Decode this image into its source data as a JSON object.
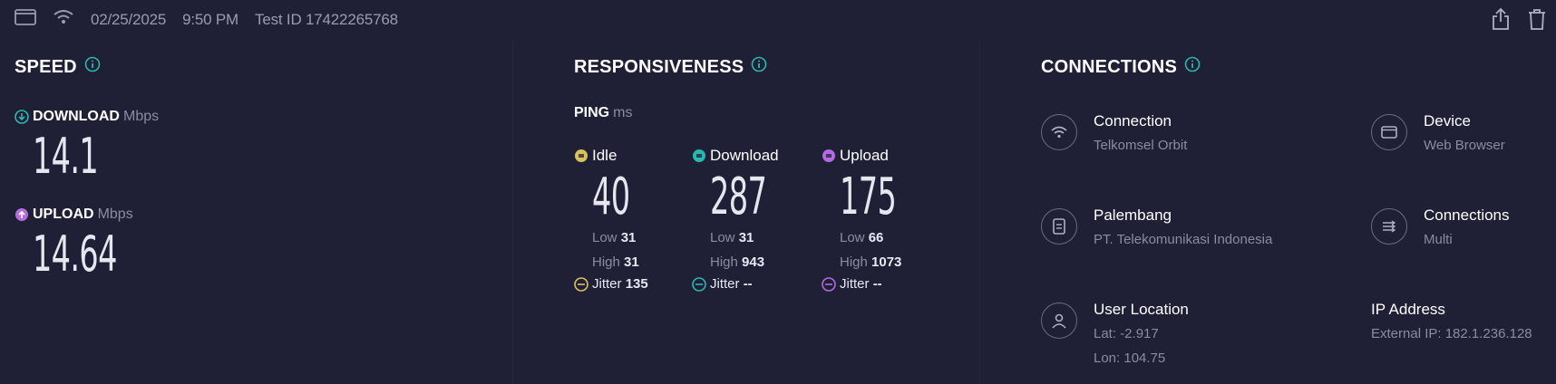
{
  "header": {
    "date": "02/25/2025",
    "time": "9:50 PM",
    "test_id": "Test ID 17422265768"
  },
  "speed": {
    "title": "SPEED",
    "download_label": "DOWNLOAD",
    "download_unit": "Mbps",
    "download_value": "14.1",
    "upload_label": "UPLOAD",
    "upload_unit": "Mbps",
    "upload_value": "14.64"
  },
  "responsiveness": {
    "title": "RESPONSIVENESS",
    "ping_label": "PING",
    "ping_unit": "ms",
    "columns": [
      {
        "label": "Idle",
        "value": "40",
        "low_label": "Low",
        "low": "31",
        "high_label": "High",
        "high": "31",
        "jitter_label": "Jitter",
        "jitter": "135"
      },
      {
        "label": "Download",
        "value": "287",
        "low_label": "Low",
        "low": "31",
        "high_label": "High",
        "high": "943",
        "jitter_label": "Jitter",
        "jitter": "--"
      },
      {
        "label": "Upload",
        "value": "175",
        "low_label": "Low",
        "low": "66",
        "high_label": "High",
        "high": "1073",
        "jitter_label": "Jitter",
        "jitter": "--"
      }
    ]
  },
  "connections": {
    "title": "CONNECTIONS",
    "items": [
      {
        "title": "Connection",
        "sub": "Telkomsel Orbit",
        "icon": "wifi-icon"
      },
      {
        "title": "Palembang",
        "sub": "PT. Telekomunikasi Indonesia",
        "icon": "server-icon"
      },
      {
        "title": "User Location",
        "sub": "Lat: -2.917",
        "sub2": "Lon: 104.75",
        "icon": "user-icon"
      },
      {
        "title": "Device",
        "sub": "Web Browser",
        "icon": "browser-icon"
      },
      {
        "title": "Connections",
        "sub": "Multi",
        "icon": "multi-connection-icon"
      },
      {
        "title": "IP Address",
        "sub": "External IP: 182.1.236.128"
      }
    ]
  },
  "colors": {
    "background": "#1f1f35",
    "accent_teal": "#2ab7b0",
    "accent_purple": "#b46be0",
    "accent_yellow": "#d8c35a"
  }
}
